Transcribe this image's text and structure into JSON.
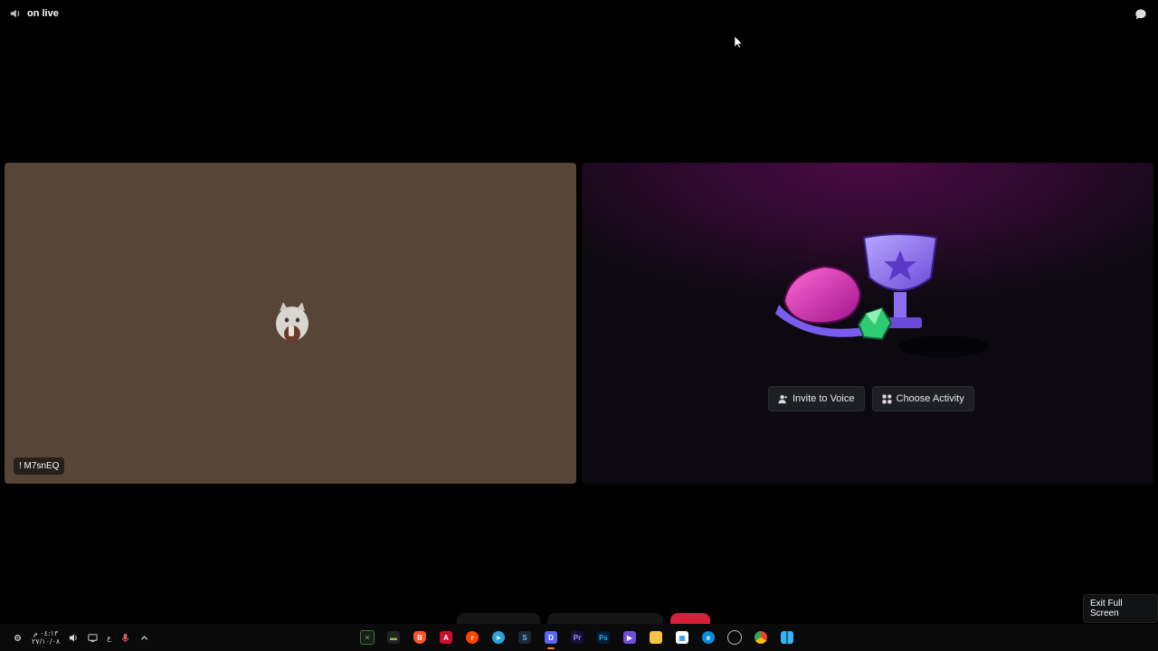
{
  "header": {
    "channel_name": "on live"
  },
  "user_tile": {
    "username": "! M7snEQ"
  },
  "activity_tile": {
    "invite_label": "Invite to Voice",
    "activity_label": "Choose Activity"
  },
  "exit_fullscreen_label": "Exit Full Screen",
  "taskbar": {
    "clock_time": "٠٤:١٣ م",
    "clock_date": "٢٧/١٠/٠٨",
    "lang": "ع",
    "apps": [
      "xbox",
      "terminal",
      "brave",
      "affinity",
      "reddit",
      "telegram",
      "steam",
      "discord",
      "premiere",
      "photoshop",
      "player",
      "file-explorer",
      "store",
      "edge",
      "chrome-like",
      "chrome",
      "windows"
    ]
  },
  "colors": {
    "user_tile_bg": "#574638",
    "end_call": "#d3213a",
    "accent_purple": "#8a2be2"
  }
}
